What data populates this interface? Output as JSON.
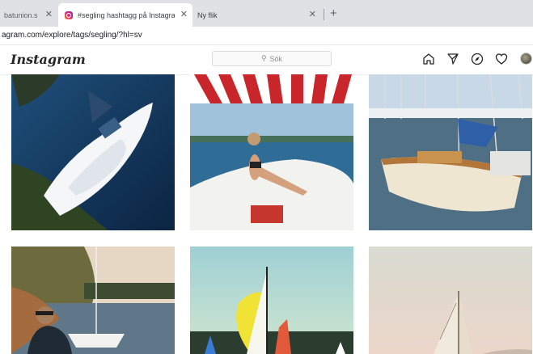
{
  "browser": {
    "tabs": [
      {
        "label": "batunion.s"
      },
      {
        "label": "#segling hashtagg på Instagram"
      },
      {
        "label": "Ny flik"
      }
    ],
    "url": "agram.com/explore/tags/segling/?hl=sv"
  },
  "instagram": {
    "logo": "Instagram",
    "search_placeholder": "Sök",
    "nav_icons": [
      "home-icon",
      "direct-icon",
      "explore-icon",
      "heart-icon",
      "avatar"
    ]
  },
  "colors": {
    "tabbar": "#dfe1e5",
    "ig_border": "#dbdbdb",
    "text": "#262626"
  },
  "grid": {
    "rows": 2,
    "columns": 3,
    "posts": [
      {
        "subject": "white sailboat on dark water, aerial view"
      },
      {
        "subject": "woman sitting on boat bow under striped awning"
      },
      {
        "subject": "wooden sailboats in marina"
      },
      {
        "subject": "man beside sailboat at rocky shore"
      },
      {
        "subject": "sailboat with yellow spinnaker"
      },
      {
        "subject": "sailboat on pale sea"
      }
    ]
  }
}
